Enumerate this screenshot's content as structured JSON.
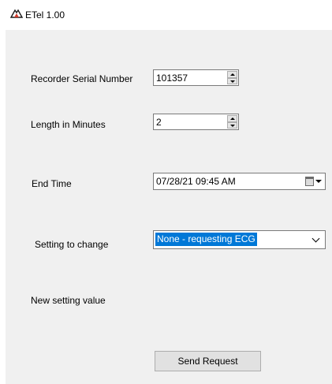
{
  "window": {
    "title": "ETel 1.00",
    "icon": "app-logo-icon"
  },
  "form": {
    "serial": {
      "label": "Recorder Serial Number",
      "value": "101357"
    },
    "length": {
      "label": "Length in Minutes",
      "value": "2"
    },
    "end_time": {
      "label": "End Time",
      "value": "07/28/21 09:45 AM"
    },
    "setting": {
      "label": "Setting to change",
      "selected": "None - requesting ECG"
    },
    "new_value": {
      "label": "New setting value"
    },
    "send_button": "Send Request"
  },
  "colors": {
    "selection": "#0078d7",
    "window_bg": "#f0f0f0",
    "button_bg": "#e1e1e1"
  }
}
